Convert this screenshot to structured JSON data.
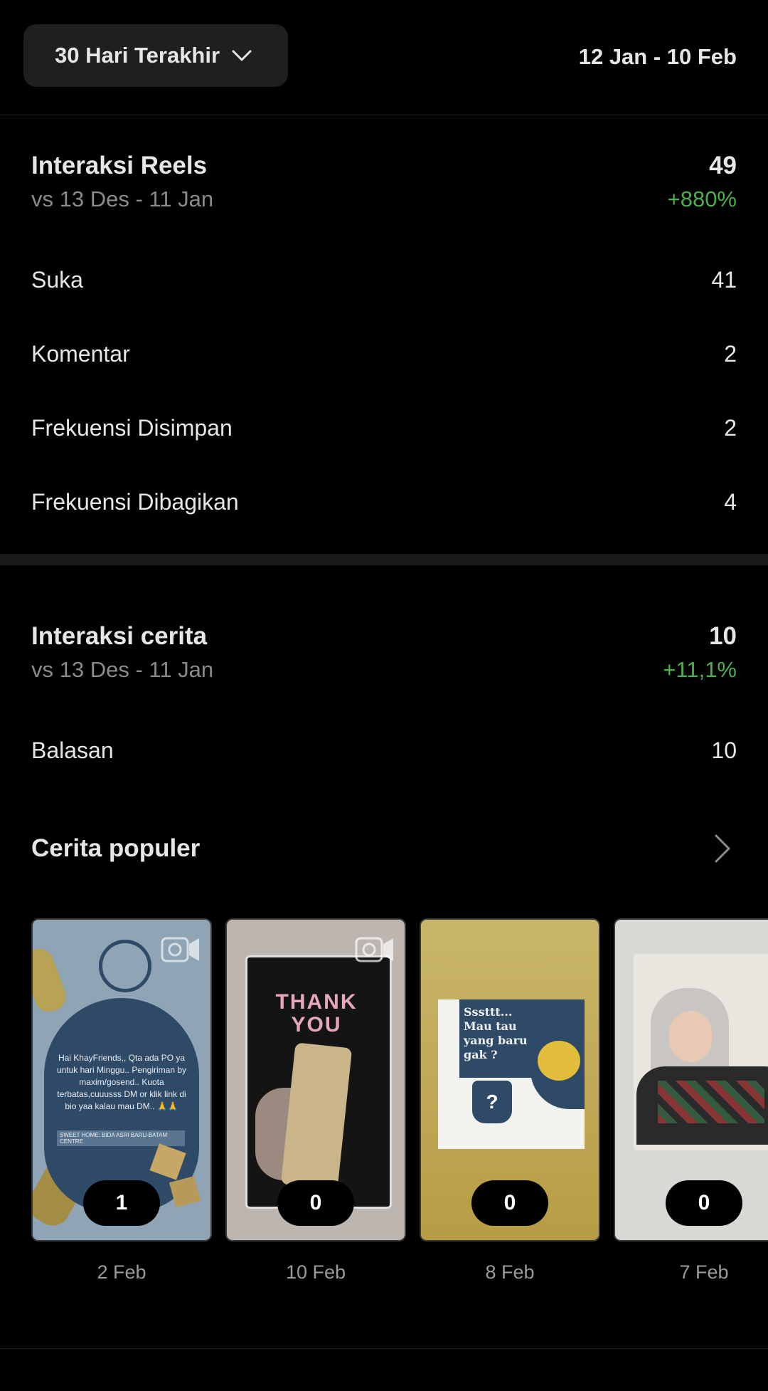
{
  "filter": {
    "range_label": "30 Hari Terakhir",
    "date_range": "12 Jan - 10 Feb"
  },
  "reels": {
    "title": "Interaksi Reels",
    "total": "49",
    "compare": "vs 13 Des - 11 Jan",
    "change": "+880%",
    "rows": [
      {
        "label": "Suka",
        "value": "41"
      },
      {
        "label": "Komentar",
        "value": "2"
      },
      {
        "label": "Frekuensi Disimpan",
        "value": "2"
      },
      {
        "label": "Frekuensi Dibagikan",
        "value": "4"
      }
    ]
  },
  "stories": {
    "title": "Interaksi cerita",
    "total": "10",
    "compare": "vs 13 Des - 11 Jan",
    "change": "+11,1%",
    "rows": [
      {
        "label": "Balasan",
        "value": "10"
      }
    ]
  },
  "popular": {
    "title": "Cerita populer",
    "items": [
      {
        "count": "1",
        "date": "2 Feb",
        "text": "Hai KhayFriends,, Qta ada PO ya untuk hari Minggu.. Pengiriman by maxim/gosend.. Kuota terbatas,cuuusss DM or klik link di bio yaa kalau mau DM.. 🙏🙏",
        "tag": "SWEET HOME: BIDA ASRI BARU-BATAM CENTRE"
      },
      {
        "count": "0",
        "date": "10 Feb",
        "text": "THANK YOU"
      },
      {
        "count": "0",
        "date": "8 Feb",
        "text": "Sssttt... Mau tau yang baru gak ?",
        "symbol": "?"
      },
      {
        "count": "0",
        "date": "7 Feb"
      }
    ]
  },
  "colors": {
    "background": "#000000",
    "positive": "#4caf50",
    "card": "#1f1f1f"
  }
}
